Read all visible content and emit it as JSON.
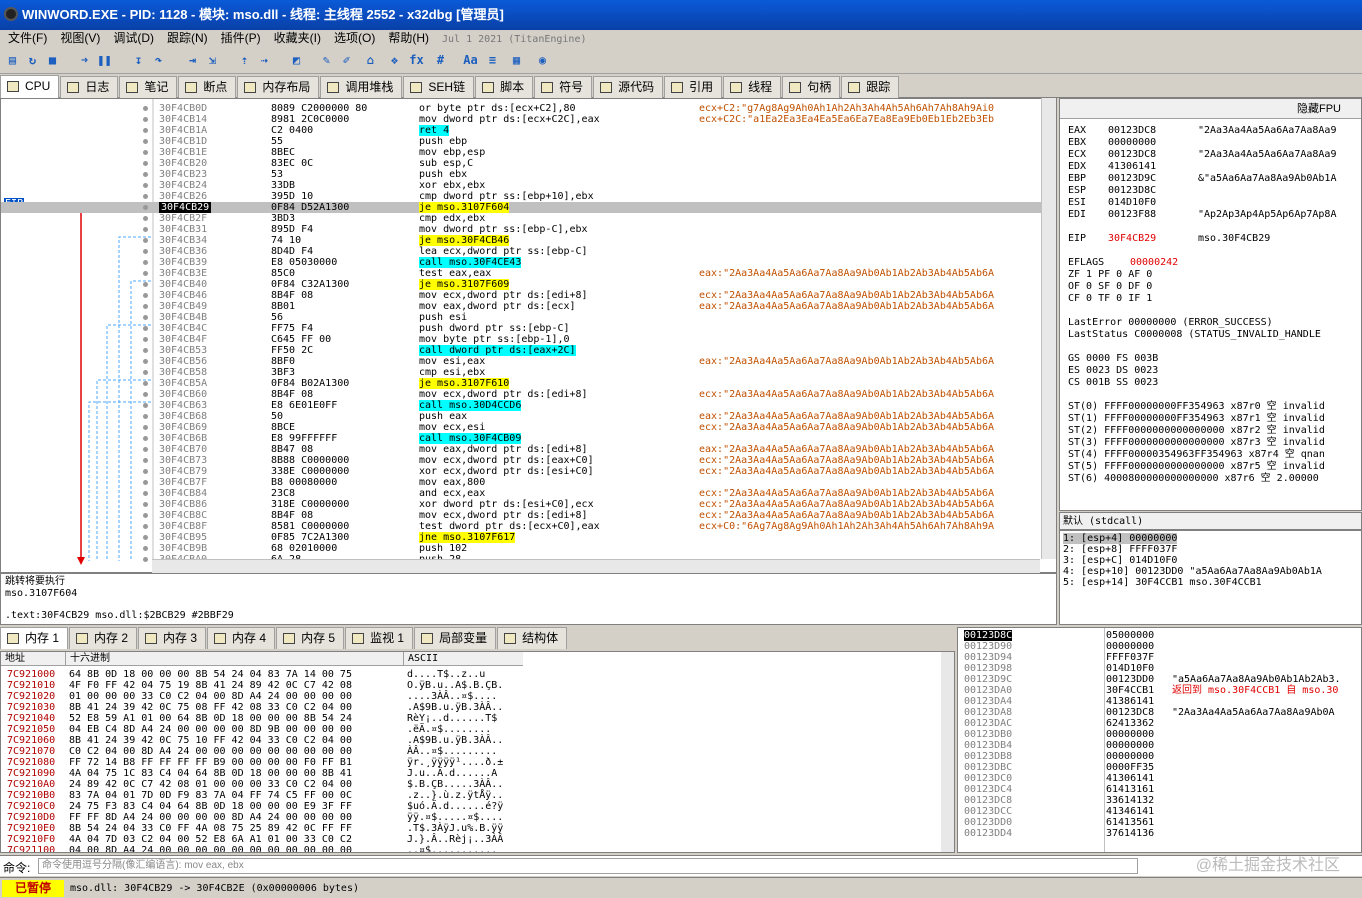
{
  "window": {
    "title": "WINWORD.EXE - PID: 1128 - 模块: mso.dll - 线程: 主线程 2552 - x32dbg [管理员]"
  },
  "menu": {
    "items": [
      "文件(F)",
      "视图(V)",
      "调试(D)",
      "跟踪(N)",
      "插件(P)",
      "收藏夹(I)",
      "选项(O)",
      "帮助(H)"
    ],
    "build": "Jul 1 2021 (TitanEngine)"
  },
  "tabs": [
    "CPU",
    "日志",
    "笔记",
    "断点",
    "内存布局",
    "调用堆栈",
    "SEH链",
    "脚本",
    "符号",
    "源代码",
    "引用",
    "线程",
    "句柄",
    "跟踪"
  ],
  "cpu": {
    "eip_label": "EIP",
    "rows": [
      [
        "30F4CB0D",
        "8089 C2000000 80",
        "or byte ptr ds:[ecx+C2],80",
        "ecx+C2:\"g7Ag8Ag9Ah0Ah1Ah2Ah3Ah4Ah5Ah6Ah7Ah8Ah9Ai0"
      ],
      [
        "30F4CB14",
        "8981 2C0C0000",
        "mov dword ptr ds:[ecx+C2C],eax",
        "ecx+C2C:\"a1Ea2Ea3Ea4Ea5Ea6Ea7Ea8Ea9Eb0Eb1Eb2Eb3Eb"
      ],
      [
        "30F4CB1A",
        "C2 0400",
        "ret 4",
        ""
      ],
      [
        "30F4CB1D",
        "55",
        "push ebp",
        ""
      ],
      [
        "30F4CB1E",
        "8BEC",
        "mov ebp,esp",
        ""
      ],
      [
        "30F4CB20",
        "83EC 0C",
        "sub esp,C",
        ""
      ],
      [
        "30F4CB23",
        "53",
        "push ebx",
        ""
      ],
      [
        "30F4CB24",
        "33DB",
        "xor ebx,ebx",
        ""
      ],
      [
        "30F4CB26",
        "395D 10",
        "cmp dword ptr ss:[ebp+10],ebx",
        ""
      ],
      [
        "30F4CB29",
        "0F84 D52A1300",
        "je mso.3107F604",
        ""
      ],
      [
        "30F4CB2F",
        "3BD3",
        "cmp edx,ebx",
        ""
      ],
      [
        "30F4CB31",
        "895D F4",
        "mov dword ptr ss:[ebp-C],ebx",
        ""
      ],
      [
        "30F4CB34",
        "74 10",
        "je mso.30F4CB46",
        ""
      ],
      [
        "30F4CB36",
        "8D4D F4",
        "lea ecx,dword ptr ss:[ebp-C]",
        ""
      ],
      [
        "30F4CB39",
        "E8 05030000",
        "call mso.30F4CE43",
        ""
      ],
      [
        "30F4CB3E",
        "85C0",
        "test eax,eax",
        "eax:\"2Aa3Aa4Aa5Aa6Aa7Aa8Aa9Ab0Ab1Ab2Ab3Ab4Ab5Ab6A"
      ],
      [
        "30F4CB40",
        "0F84 C32A1300",
        "je mso.3107F609",
        ""
      ],
      [
        "30F4CB46",
        "8B4F 08",
        "mov ecx,dword ptr ds:[edi+8]",
        "ecx:\"2Aa3Aa4Aa5Aa6Aa7Aa8Aa9Ab0Ab1Ab2Ab3Ab4Ab5Ab6A"
      ],
      [
        "30F4CB49",
        "8B01",
        "mov eax,dword ptr ds:[ecx]",
        "eax:\"2Aa3Aa4Aa5Aa6Aa7Aa8Aa9Ab0Ab1Ab2Ab3Ab4Ab5Ab6A"
      ],
      [
        "30F4CB4B",
        "56",
        "push esi",
        ""
      ],
      [
        "30F4CB4C",
        "FF75 F4",
        "push dword ptr ss:[ebp-C]",
        ""
      ],
      [
        "30F4CB4F",
        "C645 FF 00",
        "mov byte ptr ss:[ebp-1],0",
        ""
      ],
      [
        "30F4CB53",
        "FF50 2C",
        "call dword ptr ds:[eax+2C]",
        ""
      ],
      [
        "30F4CB56",
        "8BF0",
        "mov esi,eax",
        "eax:\"2Aa3Aa4Aa5Aa6Aa7Aa8Aa9Ab0Ab1Ab2Ab3Ab4Ab5Ab6A"
      ],
      [
        "30F4CB58",
        "3BF3",
        "cmp esi,ebx",
        ""
      ],
      [
        "30F4CB5A",
        "0F84 B02A1300",
        "je mso.3107F610",
        ""
      ],
      [
        "30F4CB60",
        "8B4F 08",
        "mov ecx,dword ptr ds:[edi+8]",
        "ecx:\"2Aa3Aa4Aa5Aa6Aa7Aa8Aa9Ab0Ab1Ab2Ab3Ab4Ab5Ab6A"
      ],
      [
        "30F4CB63",
        "E8 6E01E0FF",
        "call mso.30D4CCD6",
        ""
      ],
      [
        "30F4CB68",
        "50",
        "push eax",
        "eax:\"2Aa3Aa4Aa5Aa6Aa7Aa8Aa9Ab0Ab1Ab2Ab3Ab4Ab5Ab6A"
      ],
      [
        "30F4CB69",
        "8BCE",
        "mov ecx,esi",
        "ecx:\"2Aa3Aa4Aa5Aa6Aa7Aa8Aa9Ab0Ab1Ab2Ab3Ab4Ab5Ab6A"
      ],
      [
        "30F4CB6B",
        "E8 99FFFFFF",
        "call mso.30F4CB09",
        ""
      ],
      [
        "30F4CB70",
        "8B47 08",
        "mov eax,dword ptr ds:[edi+8]",
        "eax:\"2Aa3Aa4Aa5Aa6Aa7Aa8Aa9Ab0Ab1Ab2Ab3Ab4Ab5Ab6A"
      ],
      [
        "30F4CB73",
        "8B88 C0000000",
        "mov ecx,dword ptr ds:[eax+C0]",
        "ecx:\"2Aa3Aa4Aa5Aa6Aa7Aa8Aa9Ab0Ab1Ab2Ab3Ab4Ab5Ab6A"
      ],
      [
        "30F4CB79",
        "338E C0000000",
        "xor ecx,dword ptr ds:[esi+C0]",
        "ecx:\"2Aa3Aa4Aa5Aa6Aa7Aa8Aa9Ab0Ab1Ab2Ab3Ab4Ab5Ab6A"
      ],
      [
        "30F4CB7F",
        "B8 00080000",
        "mov eax,800",
        ""
      ],
      [
        "30F4CB84",
        "23C8",
        "and ecx,eax",
        "ecx:\"2Aa3Aa4Aa5Aa6Aa7Aa8Aa9Ab0Ab1Ab2Ab3Ab4Ab5Ab6A"
      ],
      [
        "30F4CB86",
        "318E C0000000",
        "xor dword ptr ds:[esi+C0],ecx",
        "ecx:\"2Aa3Aa4Aa5Aa6Aa7Aa8Aa9Ab0Ab1Ab2Ab3Ab4Ab5Ab6A"
      ],
      [
        "30F4CB8C",
        "8B4F 08",
        "mov ecx,dword ptr ds:[edi+8]",
        "ecx:\"2Aa3Aa4Aa5Aa6Aa7Aa8Aa9Ab0Ab1Ab2Ab3Ab4Ab5Ab6A"
      ],
      [
        "30F4CB8F",
        "8581 C0000000",
        "test dword ptr ds:[ecx+C0],eax",
        "ecx+C0:\"6Ag7Ag8Ag9Ah0Ah1Ah2Ah3Ah4Ah5Ah6Ah7Ah8Ah9A"
      ],
      [
        "30F4CB95",
        "0F85 7C2A1300",
        "jne mso.3107F617",
        ""
      ],
      [
        "30F4CB9B",
        "68 02010000",
        "push 102",
        ""
      ],
      [
        "30F4CBA0",
        "6A 28",
        "push 28",
        ""
      ]
    ]
  },
  "info": {
    "line1": "跳转将要执行",
    "line2": "mso.3107F604",
    "line3": ".text:30F4CB29 mso.dll:$2BCB29 #2BBF29"
  },
  "regs": {
    "header": "隐藏FPU",
    "lines": [
      [
        "EAX",
        "00123DC8",
        "\"2Aa3Aa4Aa5Aa6Aa7Aa8Aa9"
      ],
      [
        "EBX",
        "00000000",
        ""
      ],
      [
        "ECX",
        "00123DC8",
        "\"2Aa3Aa4Aa5Aa6Aa7Aa8Aa9"
      ],
      [
        "EDX",
        "41306141",
        ""
      ],
      [
        "EBP",
        "00123D9C",
        "&\"a5Aa6Aa7Aa8Aa9Ab0Ab1A"
      ],
      [
        "ESP",
        "00123D8C",
        ""
      ],
      [
        "ESI",
        "014D10F0",
        ""
      ],
      [
        "EDI",
        "00123F88",
        "\"Ap2Ap3Ap4Ap5Ap6Ap7Ap8A"
      ]
    ],
    "eip": [
      "EIP",
      "30F4CB29",
      "mso.30F4CB29"
    ],
    "eflags": [
      "EFLAGS",
      "00000242"
    ],
    "flags": [
      "ZF 1  PF 0  AF 0",
      "OF 0  SF 0  DF 0",
      "CF 0  TF 0  IF 1"
    ],
    "err": [
      "LastError  00000000 (ERROR_SUCCESS)",
      "LastStatus C0000008 (STATUS_INVALID_HANDLE"
    ],
    "seg": [
      "GS 0000  FS 003B",
      "ES 0023  DS 0023",
      "CS 001B  SS 0023"
    ],
    "fpu": [
      "ST(0) FFFF00000000FF354963 x87r0 空 invalid",
      "ST(1) FFFF00000000FF354963 x87r1 空 invalid",
      "ST(2) FFFF0000000000000000 x87r2 空 invalid",
      "ST(3) FFFF0000000000000000 x87r3 空 invalid",
      "ST(4) FFFF00000354963FF354963 x87r4 空 qnan",
      "ST(5) FFFF0000000000000000 x87r5 空 invalid",
      "ST(6) 4000800000000000000 x87r6 空 2.00000"
    ]
  },
  "callconv": "默认 (stdcall)",
  "args": [
    "1: [esp+4]  00000000",
    "2: [esp+8]  FFFF037F",
    "3: [esp+C]  014D10F0",
    "4: [esp+10] 00123DD0 \"a5Aa6Aa7Aa8Aa9Ab0Ab1A",
    "5: [esp+14] 30F4CCB1 mso.30F4CCB1"
  ],
  "dumptabs": [
    "内存 1",
    "内存 2",
    "内存 3",
    "内存 4",
    "内存 5",
    "监视 1",
    "局部变量",
    "结构体"
  ],
  "dump": {
    "headers": [
      "地址",
      "十六进制",
      "ASCII"
    ],
    "rows": [
      [
        "7C921000",
        "64 8B 0D 18 00 00 00 8B 54 24 04 83 7A 14 00 75",
        "d....T$..z..u"
      ],
      [
        "7C921010",
        "4F F0 FF 42 04 75 19 8B 41 24 89 42 0C C7 42 08",
        "O.ÿB.u..A$.B.ÇB."
      ],
      [
        "7C921020",
        "01 00 00 00 33 C0 C2 04 00 8D A4 24 00 00 00 00",
        "....3ÀÂ..¤$...."
      ],
      [
        "7C921030",
        "8B 41 24 39 42 0C 75 08 FF 42 08 33 C0 C2 04 00",
        ".A$9B.u.ÿB.3ÀÂ.."
      ],
      [
        "7C921040",
        "52 E8 59 A1 01 00 64 8B 0D 18 00 00 00 8B 54 24",
        "RèY¡..d......T$"
      ],
      [
        "7C921050",
        "04 EB C4 8D A4 24 00 00 00 00 8D 9B 00 00 00 00",
        ".ëÄ.¤$........"
      ],
      [
        "7C921060",
        "8B 41 24 39 42 0C 75 10 FF 42 04 33 C0 C2 04 00",
        ".A$9B.u.ÿB.3ÀÂ.."
      ],
      [
        "7C921070",
        "C0 C2 04 00 8D A4 24 00 00 00 00 00 00 00 00 00",
        "ÀÂ..¤$........."
      ],
      [
        "7C921080",
        "FF 72 14 B8 FF FF FF FF B9 00 00 00 00 F0 FF B1",
        "ÿr.¸ÿÿÿÿ¹....ð.±"
      ],
      [
        "7C921090",
        "4A 04 75 1C 83 C4 04 64 8B 0D 18 00 00 00 8B 41",
        "J.u..Ä.d......A"
      ],
      [
        "7C9210A0",
        "24 89 42 0C C7 42 08 01 00 00 00 33 C0 C2 04 00",
        "$.B.ÇB.....3ÀÂ.."
      ],
      [
        "7C9210B0",
        "83 7A 04 01 7D 0D F9 83 7A 04 FF 74 C5 FF 00 0C",
        ".z..}.ù.z.ÿtÅÿ.."
      ],
      [
        "7C9210C0",
        "24 75 F3 83 C4 04 64 8B 0D 18 00 00 00 E9 3F FF",
        "$uó.Ä.d......é?ÿ"
      ],
      [
        "7C9210D0",
        "FF FF 8D A4 24 00 00 00 00 8D A4 24 00 00 00 00",
        "ÿÿ.¤$.....¤$...."
      ],
      [
        "7C9210E0",
        "8B 54 24 04 33 C0 FF 4A 08 75 25 89 42 0C FF FF",
        ".T$.3ÀÿJ.u%.B.ÿÿ"
      ],
      [
        "7C9210F0",
        "4A 04 7D 03 C2 04 00 52 E8 6A A1 01 00 33 C0 C2",
        "J.}.Â..Rèj¡..3ÀÂ"
      ],
      [
        "7C921100",
        "04 00 8D A4 24 00 00 00 00 00 00 00 00 00 00 00",
        "..¤$..........."
      ]
    ]
  },
  "stack": {
    "rows": [
      [
        "00123D8C",
        "05000000",
        ""
      ],
      [
        "00123D90",
        "00000000",
        ""
      ],
      [
        "00123D94",
        "FFFF037F",
        ""
      ],
      [
        "00123D98",
        "014D10F0",
        ""
      ],
      [
        "00123D9C",
        "00123DD0",
        "\"a5Aa6Aa7Aa8Aa9Ab0Ab1Ab2Ab3."
      ],
      [
        "00123DA0",
        "30F4CCB1",
        "返回到 mso.30F4CCB1 自 mso.30"
      ],
      [
        "00123DA4",
        "41386141",
        ""
      ],
      [
        "00123DA8",
        "00123DC8",
        "\"2Aa3Aa4Aa5Aa6Aa7Aa8Aa9Ab0A"
      ],
      [
        "00123DAC",
        "62413362",
        ""
      ],
      [
        "00123DB0",
        "00000000",
        ""
      ],
      [
        "00123DB4",
        "00000000",
        ""
      ],
      [
        "00123DB8",
        "00000000",
        ""
      ],
      [
        "00123DBC",
        "0000FF35",
        ""
      ],
      [
        "00123DC0",
        "41306141",
        ""
      ],
      [
        "00123DC4",
        "61413161",
        ""
      ],
      [
        "00123DC8",
        "33614132",
        ""
      ],
      [
        "00123DCC",
        "41346141",
        ""
      ],
      [
        "00123DD0",
        "61413561",
        ""
      ],
      [
        "00123DD4",
        "37614136",
        ""
      ]
    ]
  },
  "cmd": {
    "label": "命令:",
    "placeholder": "命令使用逗号分隔(像汇编语言): mov eax, ebx",
    "watermark": "@稀土掘金技术社区"
  },
  "status": {
    "state": "已暂停",
    "message": "mso.dll: 30F4CB29 -> 30F4CB2E (0x00000006 bytes)"
  }
}
